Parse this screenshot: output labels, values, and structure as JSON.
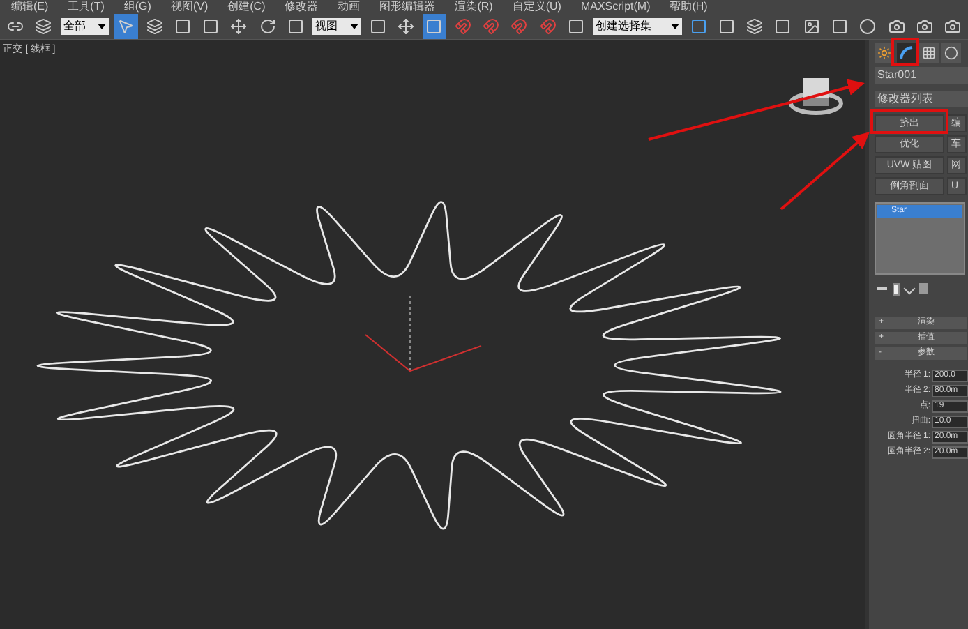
{
  "menu": [
    "编辑(E)",
    "工具(T)",
    "组(G)",
    "视图(V)",
    "创建(C)",
    "修改器",
    "动画",
    "图形编辑器",
    "渲染(R)",
    "自定义(U)",
    "MAXScript(M)",
    "帮助(H)"
  ],
  "toolbar": {
    "selection_filter": "全部",
    "reference_coordinate": "视图",
    "named_selection": "创建选择集"
  },
  "viewport": {
    "label": "正交 [ 线框 ]"
  },
  "command_panel": {
    "tabs": [
      {
        "kind": "create",
        "selected": false
      },
      {
        "kind": "modify",
        "selected": true
      },
      {
        "kind": "hierarchy",
        "selected": false
      },
      {
        "kind": "motion",
        "selected": false
      }
    ],
    "object_name": "Star001",
    "modifier_list": "修改器列表",
    "modifier_buttons": [
      "挤出",
      "编",
      "优化",
      "车",
      "UVW 贴图",
      "网",
      "倒角剖面",
      "U"
    ],
    "stack": [
      {
        "label": "Star",
        "selected": true
      }
    ],
    "rollouts": [
      {
        "sign": "+",
        "label": "渲染"
      },
      {
        "sign": "+",
        "label": "插值"
      },
      {
        "sign": "-",
        "label": "参数"
      }
    ],
    "parameters": [
      {
        "label": "半径 1:",
        "value": "200.0"
      },
      {
        "label": "半径 2:",
        "value": "80.0m"
      },
      {
        "label": "点:",
        "value": "19"
      },
      {
        "label": "扭曲:",
        "value": "10.0"
      },
      {
        "label": "圆角半径 1:",
        "value": "20.0m"
      },
      {
        "label": "圆角半径 2:",
        "value": "20.0m"
      }
    ]
  }
}
